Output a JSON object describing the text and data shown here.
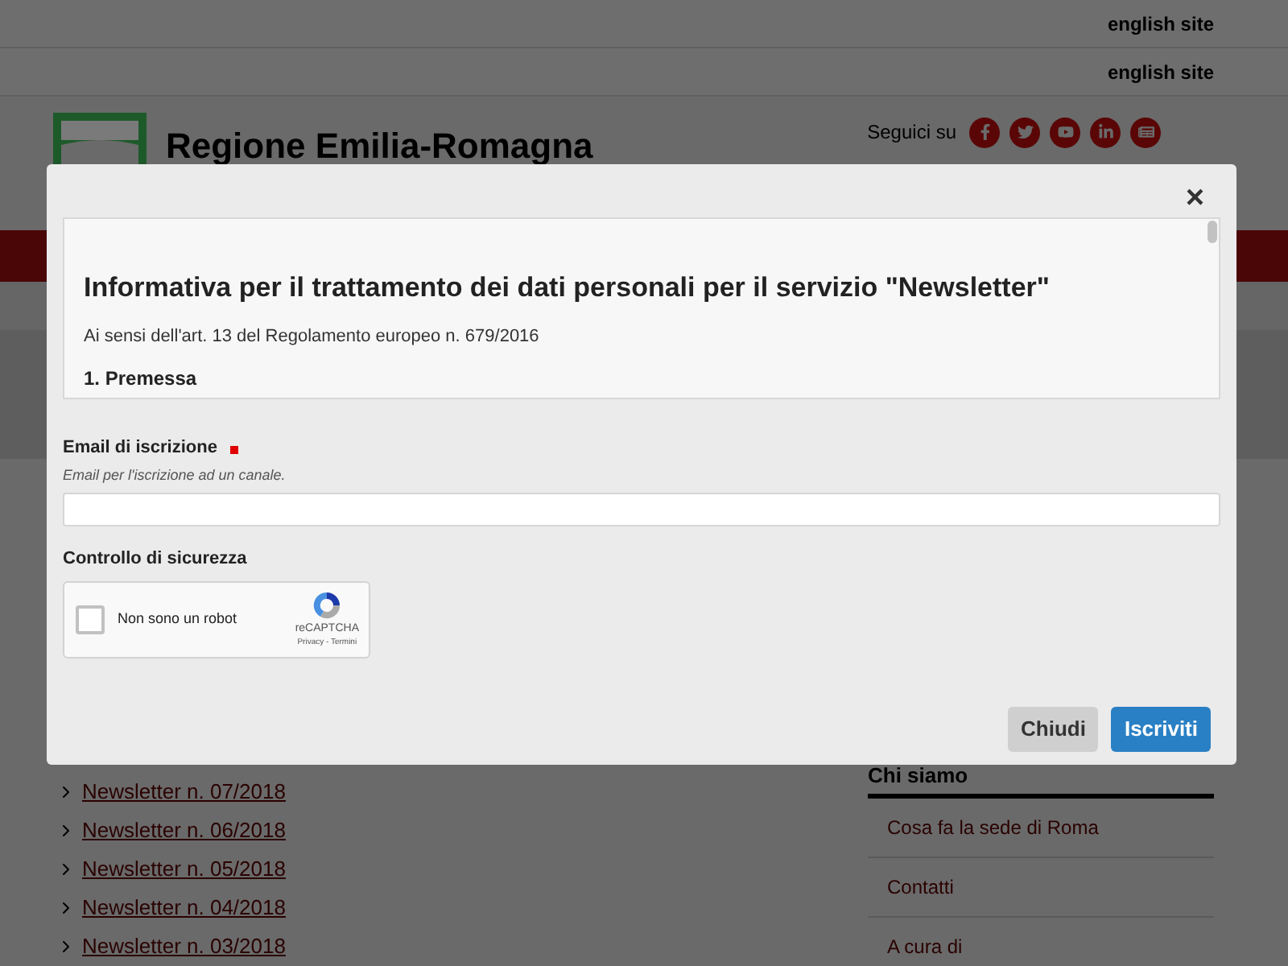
{
  "top_bars": [
    {
      "link": "english site"
    },
    {
      "link": "english site"
    }
  ],
  "header": {
    "site_title": "Regione Emilia-Romagna",
    "follow_label": "Seguici su",
    "social": [
      {
        "kind": "facebook"
      },
      {
        "kind": "twitter"
      },
      {
        "kind": "youtube"
      },
      {
        "kind": "linkedin"
      },
      {
        "kind": "newsletter"
      }
    ]
  },
  "newsletter_list": [
    "Newsletter n. 07/2018",
    "Newsletter n. 06/2018",
    "Newsletter n. 05/2018",
    "Newsletter n. 04/2018",
    "Newsletter n. 03/2018"
  ],
  "sidebar": {
    "heading": "Chi siamo",
    "items": [
      "Cosa fa la sede di Roma",
      "Contatti",
      "A cura di"
    ]
  },
  "modal": {
    "close": "×",
    "privacy": {
      "title": "Informativa per il trattamento dei dati personali per il servizio \"Newsletter\"",
      "subtitle": "Ai sensi dell'art. 13 del Regolamento europeo n. 679/2016",
      "section": "1. Premessa"
    },
    "email": {
      "label": "Email di iscrizione",
      "required": true,
      "help": "Email per l'iscrizione ad un canale."
    },
    "security": {
      "label": "Controllo di sicurezza",
      "captcha_label": "Non sono un robot",
      "checked": false,
      "brand": "reCAPTCHA",
      "links": "Privacy - Termini"
    },
    "buttons": [
      {
        "label": "Chiudi",
        "kind": "secondary"
      },
      {
        "label": "Iscriviti",
        "kind": "primary"
      }
    ]
  }
}
